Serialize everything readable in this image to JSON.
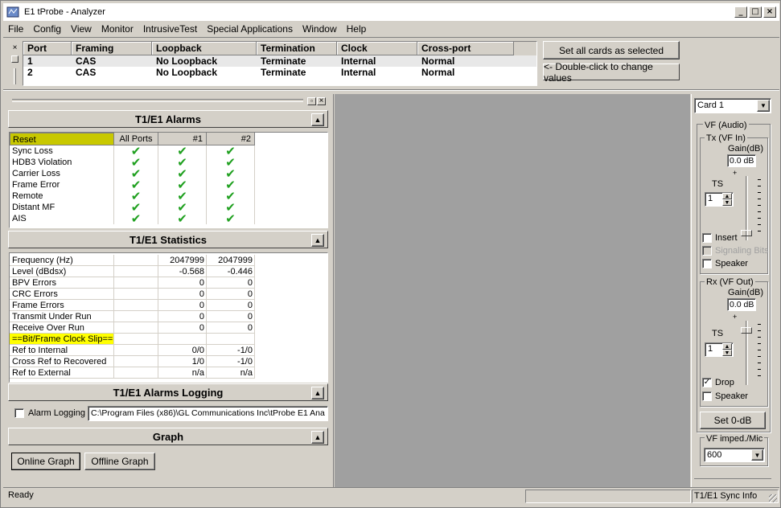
{
  "window": {
    "title": "E1 tProbe - Analyzer"
  },
  "menu": [
    "File",
    "Config",
    "View",
    "Monitor",
    "IntrusiveTest",
    "Special Applications",
    "Window",
    "Help"
  ],
  "ports": {
    "headers": [
      "Port",
      "Framing",
      "Loopback",
      "Termination",
      "Clock",
      "Cross-port"
    ],
    "rows": [
      [
        "1",
        "CAS",
        "No Loopback",
        "Terminate",
        "Internal",
        "Normal"
      ],
      [
        "2",
        "CAS",
        "No Loopback",
        "Terminate",
        "Internal",
        "Normal"
      ]
    ],
    "set_all_label": "Set all cards as selected",
    "hint_label": "<- Double-click to change values"
  },
  "alarms": {
    "title": "T1/E1 Alarms",
    "reset_label": "Reset",
    "cols": [
      "All Ports",
      "#1",
      "#2"
    ],
    "rows": [
      "Sync Loss",
      "HDB3 Violation",
      "Carrier Loss",
      "Frame Error",
      "Remote",
      "Distant MF",
      "AIS"
    ],
    "ok_glyph": "✔"
  },
  "statistics": {
    "title": "T1/E1 Statistics",
    "rows": [
      {
        "label": "Frequency (Hz)",
        "all": "",
        "p1": "2047999",
        "p2": "2047999"
      },
      {
        "label": "Level (dBdsx)",
        "all": "",
        "p1": "-0.568",
        "p2": "-0.446"
      },
      {
        "label": "BPV Errors",
        "all": "",
        "p1": "0",
        "p2": "0"
      },
      {
        "label": "CRC Errors",
        "all": "",
        "p1": "0",
        "p2": "0"
      },
      {
        "label": "Frame Errors",
        "all": "",
        "p1": "0",
        "p2": "0"
      },
      {
        "label": "Transmit Under Run",
        "all": "",
        "p1": "0",
        "p2": "0"
      },
      {
        "label": "Receive Over Run",
        "all": "",
        "p1": "0",
        "p2": "0"
      },
      {
        "label": "==Bit/Frame Clock Slip==",
        "all": "",
        "p1": "",
        "p2": ""
      },
      {
        "label": "Ref to Internal",
        "all": "",
        "p1": "0/0",
        "p2": "-1/0"
      },
      {
        "label": "Cross Ref to Recovered",
        "all": "",
        "p1": "1/0",
        "p2": "-1/0"
      },
      {
        "label": "Ref to External",
        "all": "",
        "p1": "n/a",
        "p2": "n/a"
      }
    ]
  },
  "logging": {
    "title": "T1/E1 Alarms Logging",
    "checkbox_label": "Alarm Logging",
    "path": "C:\\Program Files (x86)\\GL Communications Inc\\tProbe E1 Ana"
  },
  "graph": {
    "title": "Graph",
    "online_label": "Online Graph",
    "offline_label": "Offline Graph"
  },
  "right": {
    "card_select": "Card 1",
    "vf_audio": "VF (Audio)",
    "tx": {
      "title": "Tx (VF In)",
      "gain_label": "Gain(dB)",
      "gain_value": "0.0 dB",
      "plus": "+",
      "ts_label": "TS",
      "ts_value": "1",
      "insert": "Insert",
      "signaling": "Signaling Bits",
      "speaker": "Speaker"
    },
    "rx": {
      "title": "Rx (VF Out)",
      "gain_label": "Gain(dB)",
      "gain_value": "0.0 dB",
      "plus": "+",
      "ts_label": "TS",
      "ts_value": "1",
      "drop": "Drop",
      "speaker": "Speaker"
    },
    "set0_label": "Set 0-dB",
    "imped_title": "VF imped./Mic",
    "imped_value": "600"
  },
  "status": {
    "left": "Ready",
    "right": "T1/E1 Sync Info"
  },
  "colors": {
    "highlight": "#ffff00",
    "reset_bg": "#c8c800",
    "check": "#1fa01f",
    "workspace": "#a0a0a0"
  }
}
